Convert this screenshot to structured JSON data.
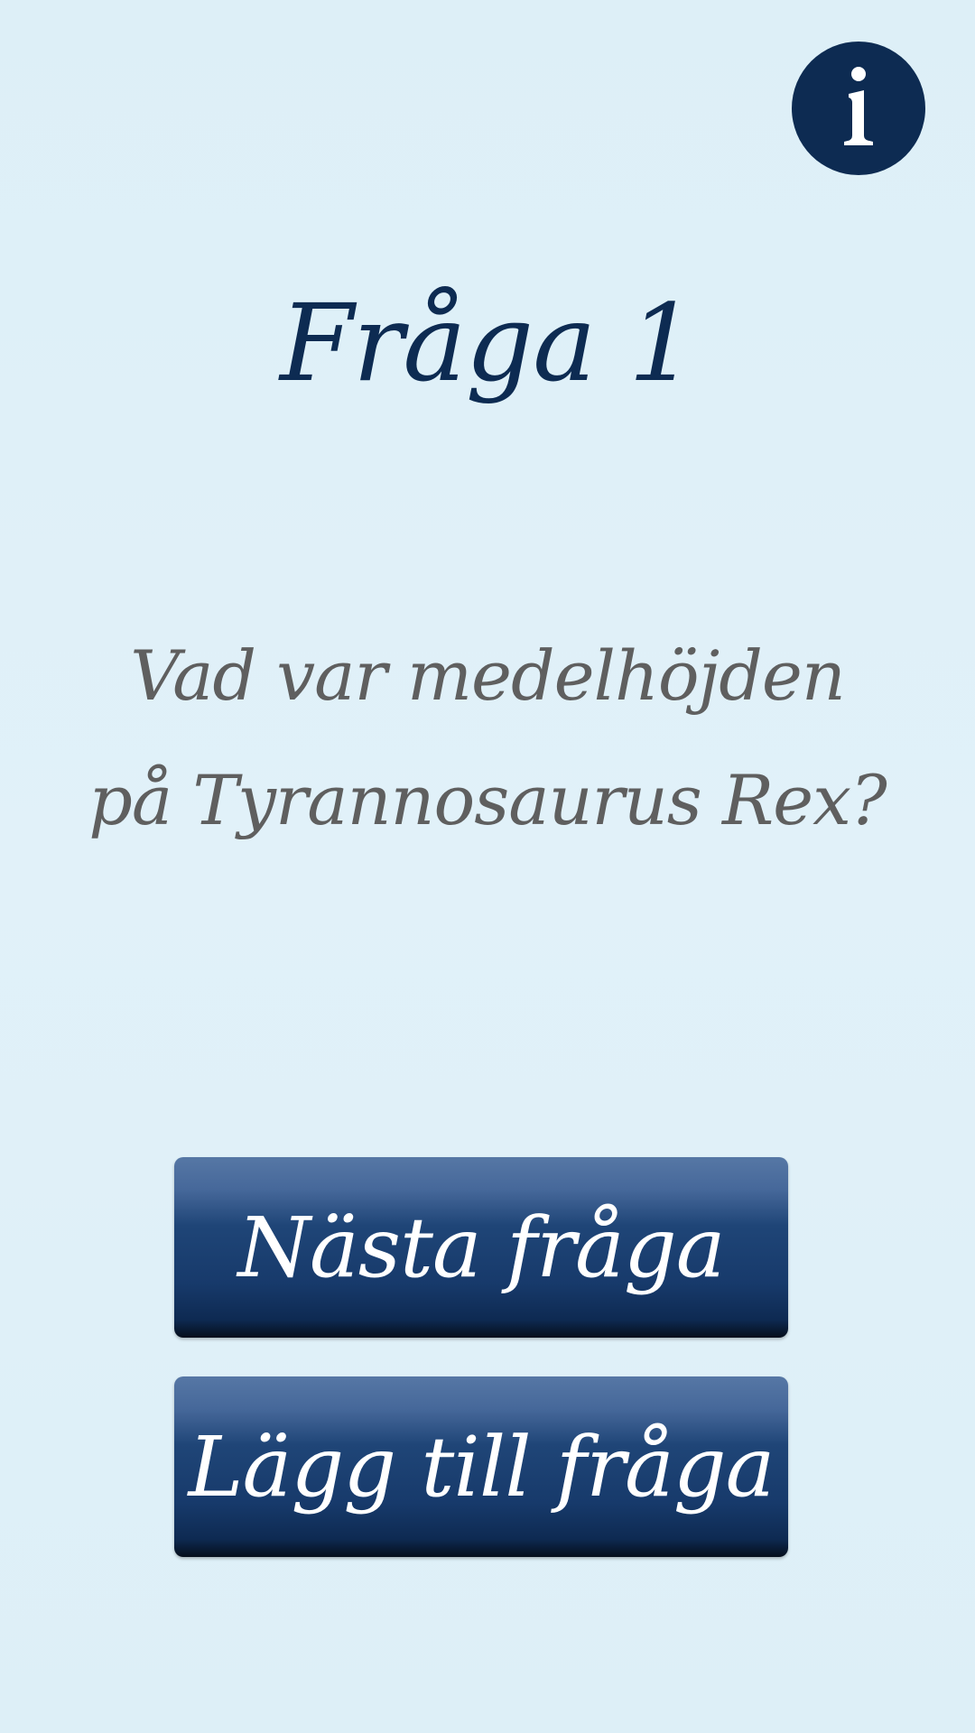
{
  "info_button": {
    "icon": "info-icon",
    "glyph": "i",
    "background": "#0d2b52"
  },
  "title": "Fråga 1",
  "question": "Vad var medelhöjden på Tyrannosaurus Rex?",
  "buttons": {
    "next_label": "Nästa fråga",
    "add_label": "Lägg till fråga"
  },
  "colors": {
    "background": "#dff0f8",
    "title": "#0d2b52",
    "question": "#5f5f5f",
    "button_top": "#5677a5",
    "button_bottom": "#0e2a52",
    "button_text": "#ffffff"
  }
}
